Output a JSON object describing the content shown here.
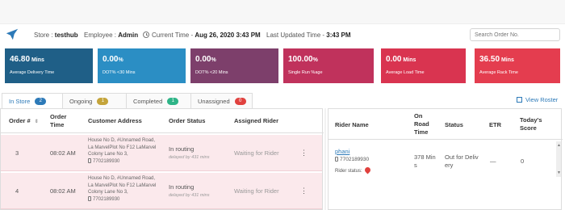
{
  "header": {
    "store_prefix": "Store : ",
    "store": "testhub",
    "employee_prefix": "Employee : ",
    "employee": "Admin",
    "current_time_prefix": "Current Time - ",
    "current_time": "Aug 26, 2020 3:43 PM",
    "updated_prefix": "Last Updated Time - ",
    "updated_time": "3:43 PM",
    "search_placeholder": "Search Order No."
  },
  "cards": [
    {
      "value": "46.80",
      "unit": " Mins",
      "label": "Average Delivery Time",
      "color": "#1f5f87"
    },
    {
      "value": "0.00",
      "unit": "%",
      "label": "DOT% <30 Mins",
      "color": "#2b8ec4"
    },
    {
      "value": "0.00",
      "unit": "%",
      "label": "DOT% <20 Mins",
      "color": "#7d3f6b"
    },
    {
      "value": "100.00",
      "unit": "%",
      "label": "Single Run %age",
      "color": "#c0325c"
    },
    {
      "value": "0.00",
      "unit": " Mins",
      "label": "Average Load Time",
      "color": "#d93450"
    },
    {
      "value": "36.50",
      "unit": " Mins",
      "label": "Average Rack Time",
      "color": "#e43d4f"
    }
  ],
  "tabs": [
    {
      "label": "In Store",
      "count": "2",
      "badge_color": "#2d7ab8"
    },
    {
      "label": "Ongoing",
      "count": "1",
      "badge_color": "#e0a42b"
    },
    {
      "label": "Completed",
      "count": "1",
      "badge_color": "#2eb487"
    },
    {
      "label": "Unassigned",
      "count": "0",
      "badge_color": "#e0413e"
    }
  ],
  "view_roster": "View Roster",
  "orders": {
    "headers": {
      "order_no": "Order #",
      "order_time_1": "Order",
      "order_time_2": "Time",
      "address": "Customer Address",
      "status": "Order Status",
      "rider": "Assigned Rider"
    },
    "rows": [
      {
        "order_no": "3",
        "time": "08:02 AM",
        "addr1": "House No D, #Unnamed Road,",
        "addr2": "La MarvelPlot No F12 LaMarvel",
        "addr3": "Colony Lane No 3,",
        "phone": "7702189930",
        "status": "In routing",
        "delay": "delayed by 431 mins",
        "rider": "Waiting for Rider",
        "menu": "⋮"
      },
      {
        "order_no": "4",
        "time": "08:02 AM",
        "addr1": "House No D, #Unnamed Road,",
        "addr2": "La MarvelPlot No F12 LaMarvel",
        "addr3": "Colony Lane No 3,",
        "phone": "7702189930",
        "status": "In routing",
        "delay": "delayed by 431 mins",
        "rider": "Waiting for Rider",
        "menu": "⋮"
      }
    ]
  },
  "riders": {
    "headers": {
      "name": "Rider Name",
      "on_road_1": "On",
      "on_road_2": "Road",
      "on_road_3": "Time",
      "status": "Status",
      "etr": "ETR",
      "score_1": "Today's",
      "score_2": "Score"
    },
    "rows": [
      {
        "name": "phani",
        "phone": "7702189930",
        "rider_status_label": "Rider status:",
        "on_road_1": "378 Min",
        "on_road_2": "s",
        "status_1": "Out for Deliv",
        "status_2": "ery",
        "etr": "—",
        "score": "0"
      }
    ]
  },
  "icons": {
    "logo": "bird-logo-icon",
    "clock": "clock-icon",
    "roster": "roster-icon",
    "sort": "sort-icon",
    "phone": "phone-icon",
    "pin": "map-pin-icon"
  }
}
